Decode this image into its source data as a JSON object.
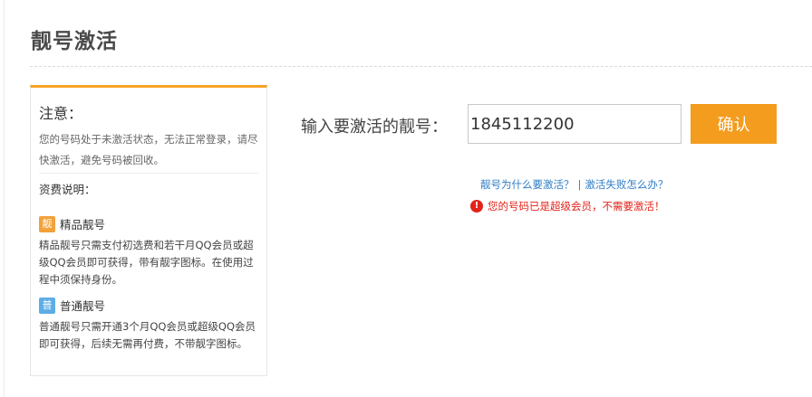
{
  "page": {
    "title": "靓号激活"
  },
  "notice": {
    "heading": "注意：",
    "text": "您的号码处于未激活状态，无法正常登录，请尽快激活，避免号码被回收。",
    "fee_heading": "资费说明：",
    "tiers": [
      {
        "badge": "靓",
        "name": "精品靓号",
        "color": "#f3a13a",
        "desc": "精品靓号只需支付初选费和若干月QQ会员或超级QQ会员即可获得，带有靓字图标。在使用过程中须保持身份。"
      },
      {
        "badge": "普",
        "name": "普通靓号",
        "color": "#5dade6",
        "desc": "普通靓号只需开通3个月QQ会员或超级QQ会员即可获得，后续无需再付费，不带靓字图标。"
      }
    ]
  },
  "form": {
    "label": "输入要激活的靓号：",
    "number_value": "1845112200",
    "confirm_label": "确认"
  },
  "help": {
    "why_link": "靓号为什么要激活？",
    "separator": "|",
    "fail_link": "激活失败怎么办？"
  },
  "error": {
    "icon": "!",
    "message": "您的号码已是超级会员，不需要激活！"
  },
  "colors": {
    "accent": "#f39c1d",
    "link": "#2f7dc6",
    "error": "#e2231a"
  }
}
